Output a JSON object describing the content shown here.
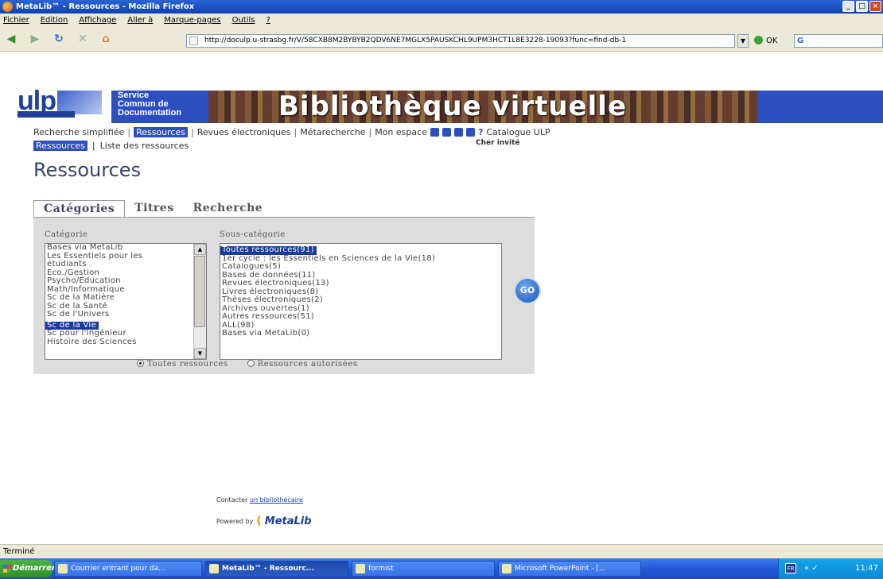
{
  "window": {
    "title": "MetaLib™ - Ressources - Mozilla Firefox"
  },
  "menu": {
    "items": [
      "Fichier",
      "Edition",
      "Affichage",
      "Aller à",
      "Marque-pages",
      "Outils",
      "?"
    ]
  },
  "nav": {
    "url": "http://doculp.u-strasbg.fr/V/58CXB8M2BYBYB2QDV6NE7MGLX5PAUSKCHL9UPM3HCT1L8E3228-19093?func=find-db-1",
    "go_label": "OK",
    "search_value": "G"
  },
  "banner": {
    "logo": "ulp",
    "service_lines": [
      "Service",
      "Commun de",
      "Documentation"
    ],
    "title": "Bibliothèque virtuelle"
  },
  "topnav": {
    "items": [
      "Recherche simplifiée",
      "Ressources",
      "Revues électroniques",
      "Métarecherche",
      "Mon espace"
    ],
    "catalogue": "Catalogue ULP"
  },
  "subnav": {
    "items": [
      "Ressources",
      "Liste des ressources"
    ]
  },
  "greeting": "Cher invité",
  "page_title": "Ressources",
  "tabs": [
    "Catégories",
    "Titres",
    "Recherche"
  ],
  "category": {
    "label": "Catégorie",
    "options": [
      "Bases via MetaLib",
      "Les Essentiels pour les",
      "étudiants",
      "Eco./Gestion",
      "Psycho/Education",
      "Math/Informatique",
      "Sc de la Matière",
      "Sc de la Santé",
      "Sc de l'Univers",
      "Sc de la Vie",
      "Sc pour l'Ingénieur",
      "Histoire des Sciences"
    ],
    "selected_index": 9
  },
  "subcategory": {
    "label": "Sous-catégorie",
    "options": [
      "Toutes ressources(91)",
      "1er cycle : les Essentiels en Sciences de la Vie(18)",
      "Catalogues(5)",
      "Bases de données(11)",
      "Revues électroniques(13)",
      "Livres électroniques(8)",
      "Thèses électroniques(2)",
      "Archives ouvertes(1)",
      "Autres ressources(51)",
      "ALL(98)",
      "Bases via MetaLib(0)"
    ],
    "selected_index": 0
  },
  "go_button": "GO",
  "radios": {
    "all": "Toutes ressources",
    "authorized": "Ressources autorisées",
    "selected": "all"
  },
  "footer": {
    "contact_prefix": "Contacter",
    "contact_link": "un bibliothécaire",
    "powered": "Powered by",
    "metalib": "MetaLib"
  },
  "status": "Terminé",
  "taskbar": {
    "start": "Démarrer",
    "tasks": [
      "Courrier entrant pour da...",
      "MetaLib™ - Ressourc...",
      "formist",
      "Microsoft PowerPoint - [..."
    ],
    "lang": "FR",
    "clock": "11:47"
  }
}
